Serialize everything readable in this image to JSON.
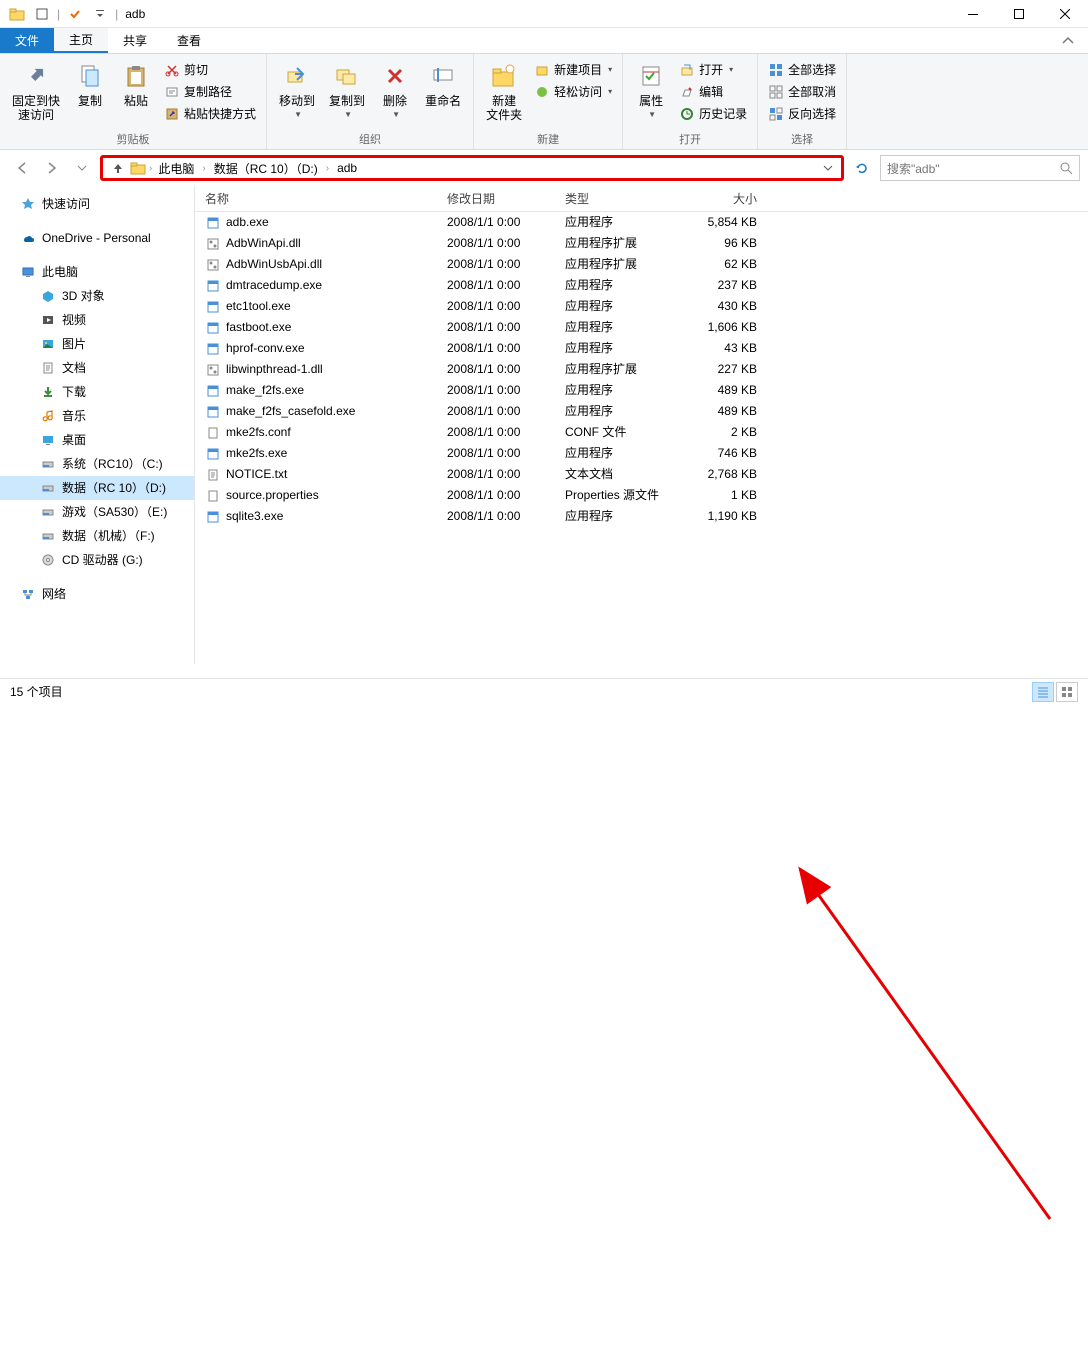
{
  "window": {
    "title": "adb"
  },
  "menu": {
    "file": "文件",
    "home": "主页",
    "share": "共享",
    "view": "查看"
  },
  "ribbon": {
    "clipboard": {
      "label": "剪贴板",
      "pin": "固定到快\n速访问",
      "copy": "复制",
      "paste": "粘贴",
      "cut": "剪切",
      "copypath": "复制路径",
      "pasteshortcut": "粘贴快捷方式"
    },
    "organize": {
      "label": "组织",
      "moveto": "移动到",
      "copyto": "复制到",
      "delete": "删除",
      "rename": "重命名"
    },
    "new": {
      "label": "新建",
      "newfolder": "新建\n文件夹",
      "newitem": "新建项目",
      "easyaccess": "轻松访问"
    },
    "open": {
      "label": "打开",
      "properties": "属性",
      "open": "打开",
      "edit": "编辑",
      "history": "历史记录"
    },
    "select": {
      "label": "选择",
      "selectall": "全部选择",
      "selectnone": "全部取消",
      "invertsel": "反向选择"
    }
  },
  "breadcrumb": {
    "b1": "此电脑",
    "b2": "数据（RC 10）（D:)",
    "b3": "adb"
  },
  "search": {
    "placeholder": "搜索\"adb\""
  },
  "nav": {
    "quick": "快速访问",
    "onedrive": "OneDrive - Personal",
    "thispc": "此电脑",
    "obj3d": "3D 对象",
    "videos": "视频",
    "pictures": "图片",
    "documents": "文档",
    "downloads": "下载",
    "music": "音乐",
    "desktop": "桌面",
    "sysdrive": "系统（RC10）（C:)",
    "datadrive": "数据（RC 10）（D:)",
    "gamedrive": "游戏（SA530）（E:)",
    "mechdrive": "数据（机械）（F:)",
    "cddrive": "CD 驱动器 (G:)",
    "network": "网络"
  },
  "columns": {
    "name": "名称",
    "modified": "修改日期",
    "type": "类型",
    "size": "大小"
  },
  "files": [
    {
      "name": "adb.exe",
      "date": "2008/1/1 0:00",
      "type": "应用程序",
      "size": "5,854 KB",
      "icon": "exe"
    },
    {
      "name": "AdbWinApi.dll",
      "date": "2008/1/1 0:00",
      "type": "应用程序扩展",
      "size": "96 KB",
      "icon": "dll"
    },
    {
      "name": "AdbWinUsbApi.dll",
      "date": "2008/1/1 0:00",
      "type": "应用程序扩展",
      "size": "62 KB",
      "icon": "dll"
    },
    {
      "name": "dmtracedump.exe",
      "date": "2008/1/1 0:00",
      "type": "应用程序",
      "size": "237 KB",
      "icon": "exe"
    },
    {
      "name": "etc1tool.exe",
      "date": "2008/1/1 0:00",
      "type": "应用程序",
      "size": "430 KB",
      "icon": "exe"
    },
    {
      "name": "fastboot.exe",
      "date": "2008/1/1 0:00",
      "type": "应用程序",
      "size": "1,606 KB",
      "icon": "exe"
    },
    {
      "name": "hprof-conv.exe",
      "date": "2008/1/1 0:00",
      "type": "应用程序",
      "size": "43 KB",
      "icon": "exe"
    },
    {
      "name": "libwinpthread-1.dll",
      "date": "2008/1/1 0:00",
      "type": "应用程序扩展",
      "size": "227 KB",
      "icon": "dll"
    },
    {
      "name": "make_f2fs.exe",
      "date": "2008/1/1 0:00",
      "type": "应用程序",
      "size": "489 KB",
      "icon": "exe"
    },
    {
      "name": "make_f2fs_casefold.exe",
      "date": "2008/1/1 0:00",
      "type": "应用程序",
      "size": "489 KB",
      "icon": "exe"
    },
    {
      "name": "mke2fs.conf",
      "date": "2008/1/1 0:00",
      "type": "CONF 文件",
      "size": "2 KB",
      "icon": "file"
    },
    {
      "name": "mke2fs.exe",
      "date": "2008/1/1 0:00",
      "type": "应用程序",
      "size": "746 KB",
      "icon": "exe"
    },
    {
      "name": "NOTICE.txt",
      "date": "2008/1/1 0:00",
      "type": "文本文档",
      "size": "2,768 KB",
      "icon": "txt"
    },
    {
      "name": "source.properties",
      "date": "2008/1/1 0:00",
      "type": "Properties 源文件",
      "size": "1 KB",
      "icon": "file"
    },
    {
      "name": "sqlite3.exe",
      "date": "2008/1/1 0:00",
      "type": "应用程序",
      "size": "1,190 KB",
      "icon": "exe"
    }
  ],
  "status": {
    "items": "15 个项目"
  }
}
